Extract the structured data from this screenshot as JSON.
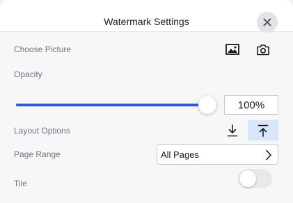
{
  "dialog": {
    "title": "Watermark Settings",
    "close_icon": "close-icon"
  },
  "picture": {
    "label": "Choose Picture",
    "gallery_icon": "image-icon",
    "camera_icon": "camera-icon"
  },
  "opacity": {
    "label": "Opacity",
    "value": 100,
    "value_text": "100%"
  },
  "layout": {
    "label": "Layout Options",
    "options": [
      {
        "icon": "arrow-down-to-line-icon",
        "selected": false
      },
      {
        "icon": "arrow-up-from-line-icon",
        "selected": true
      }
    ]
  },
  "page_range": {
    "label": "Page Range",
    "value": "All Pages",
    "chevron_icon": "chevron-right-icon"
  },
  "tile": {
    "label": "Tile",
    "enabled": false
  },
  "colors": {
    "accent": "#2d5bd6",
    "selected_bg": "#d8e6fb"
  }
}
